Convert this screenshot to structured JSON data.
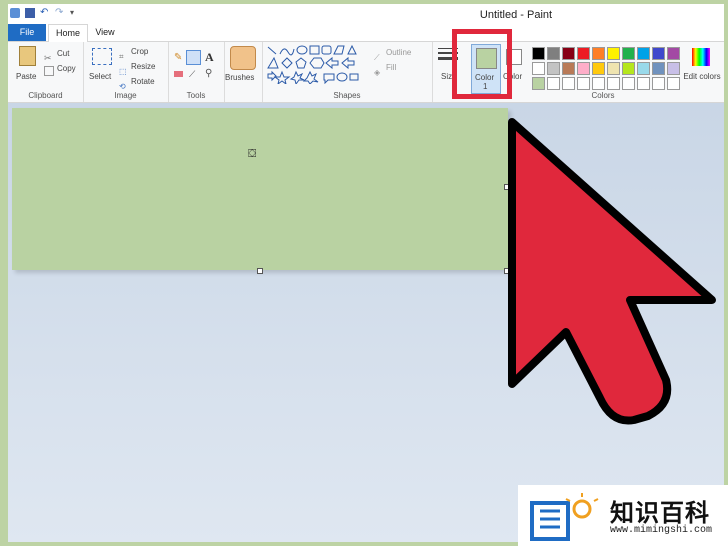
{
  "window": {
    "title": "Untitled - Paint"
  },
  "tabs": [
    {
      "label": "File"
    },
    {
      "label": "Home"
    },
    {
      "label": "View"
    }
  ],
  "ribbon": {
    "clipboard": {
      "paste": "Paste",
      "cut": "Cut",
      "copy": "Copy",
      "label": "Clipboard"
    },
    "image": {
      "select": "Select",
      "crop": "Crop",
      "resize": "Resize",
      "rotate": "Rotate",
      "label": "Image"
    },
    "tools": {
      "label": "Tools"
    },
    "brushes": {
      "label": "Brushes"
    },
    "shapes": {
      "outline": "Outline",
      "fill": "Fill",
      "label": "Shapes"
    },
    "size": {
      "label": "Size"
    },
    "color1": {
      "label": "Color",
      "num": "1",
      "value": "#b9d2a2"
    },
    "color2": {
      "label": "Color"
    },
    "colors": {
      "label": "Colors",
      "edit": "Edit colors"
    },
    "palette": [
      "#000000",
      "#7f7f7f",
      "#880015",
      "#ed1c24",
      "#ff7f27",
      "#fff200",
      "#22b14c",
      "#00a2e8",
      "#3f48cc",
      "#a349a4",
      "#ffffff",
      "#c3c3c3",
      "#b97a57",
      "#ffaec9",
      "#ffc90e",
      "#efe4b0",
      "#b5e61d",
      "#99d9ea",
      "#7092be",
      "#c8bfe7",
      "#b9d2a2",
      "#ffffff",
      "#ffffff",
      "#ffffff",
      "#ffffff",
      "#ffffff",
      "#ffffff",
      "#ffffff",
      "#ffffff",
      "#ffffff"
    ]
  },
  "watermark": {
    "cn": "知识百科",
    "url": "www.mimingshi.com"
  },
  "colors": {
    "accent": "#1f6cc4",
    "highlight": "#e0283c",
    "arrow": "#e0283c",
    "canvas": "#b9d2a2"
  }
}
